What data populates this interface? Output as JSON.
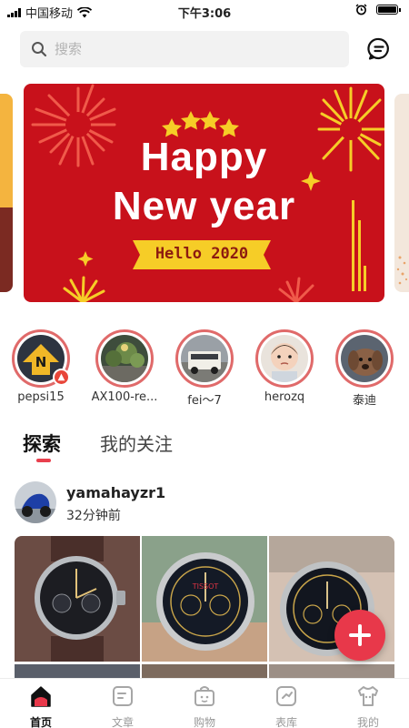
{
  "status_bar": {
    "carrier": "中国移动",
    "time": "下午3:06"
  },
  "search": {
    "placeholder": "搜索"
  },
  "banner": {
    "line1": "Happy",
    "line2": "New year",
    "ribbon": "Hello 2020"
  },
  "stories": [
    {
      "name": "pepsi15",
      "badge": "fire-icon"
    },
    {
      "name": "AX100-re..."
    },
    {
      "name": "fei～7"
    },
    {
      "name": "herozq"
    },
    {
      "name": "泰迪"
    }
  ],
  "tabs": {
    "explore": "探索",
    "following": "我的关注"
  },
  "post": {
    "username": "yamahayzr1",
    "time": "32分钟前"
  },
  "bottom_nav": [
    {
      "label": "首页",
      "icon": "home-icon",
      "active": true
    },
    {
      "label": "文章",
      "icon": "article-icon"
    },
    {
      "label": "购物",
      "icon": "shopping-bag-icon"
    },
    {
      "label": "表库",
      "icon": "watch-library-icon"
    },
    {
      "label": "我的",
      "icon": "profile-shirt-icon"
    }
  ],
  "colors": {
    "accent": "#e8384a",
    "banner_red": "#c8111b",
    "banner_gold": "#f6cd27"
  }
}
